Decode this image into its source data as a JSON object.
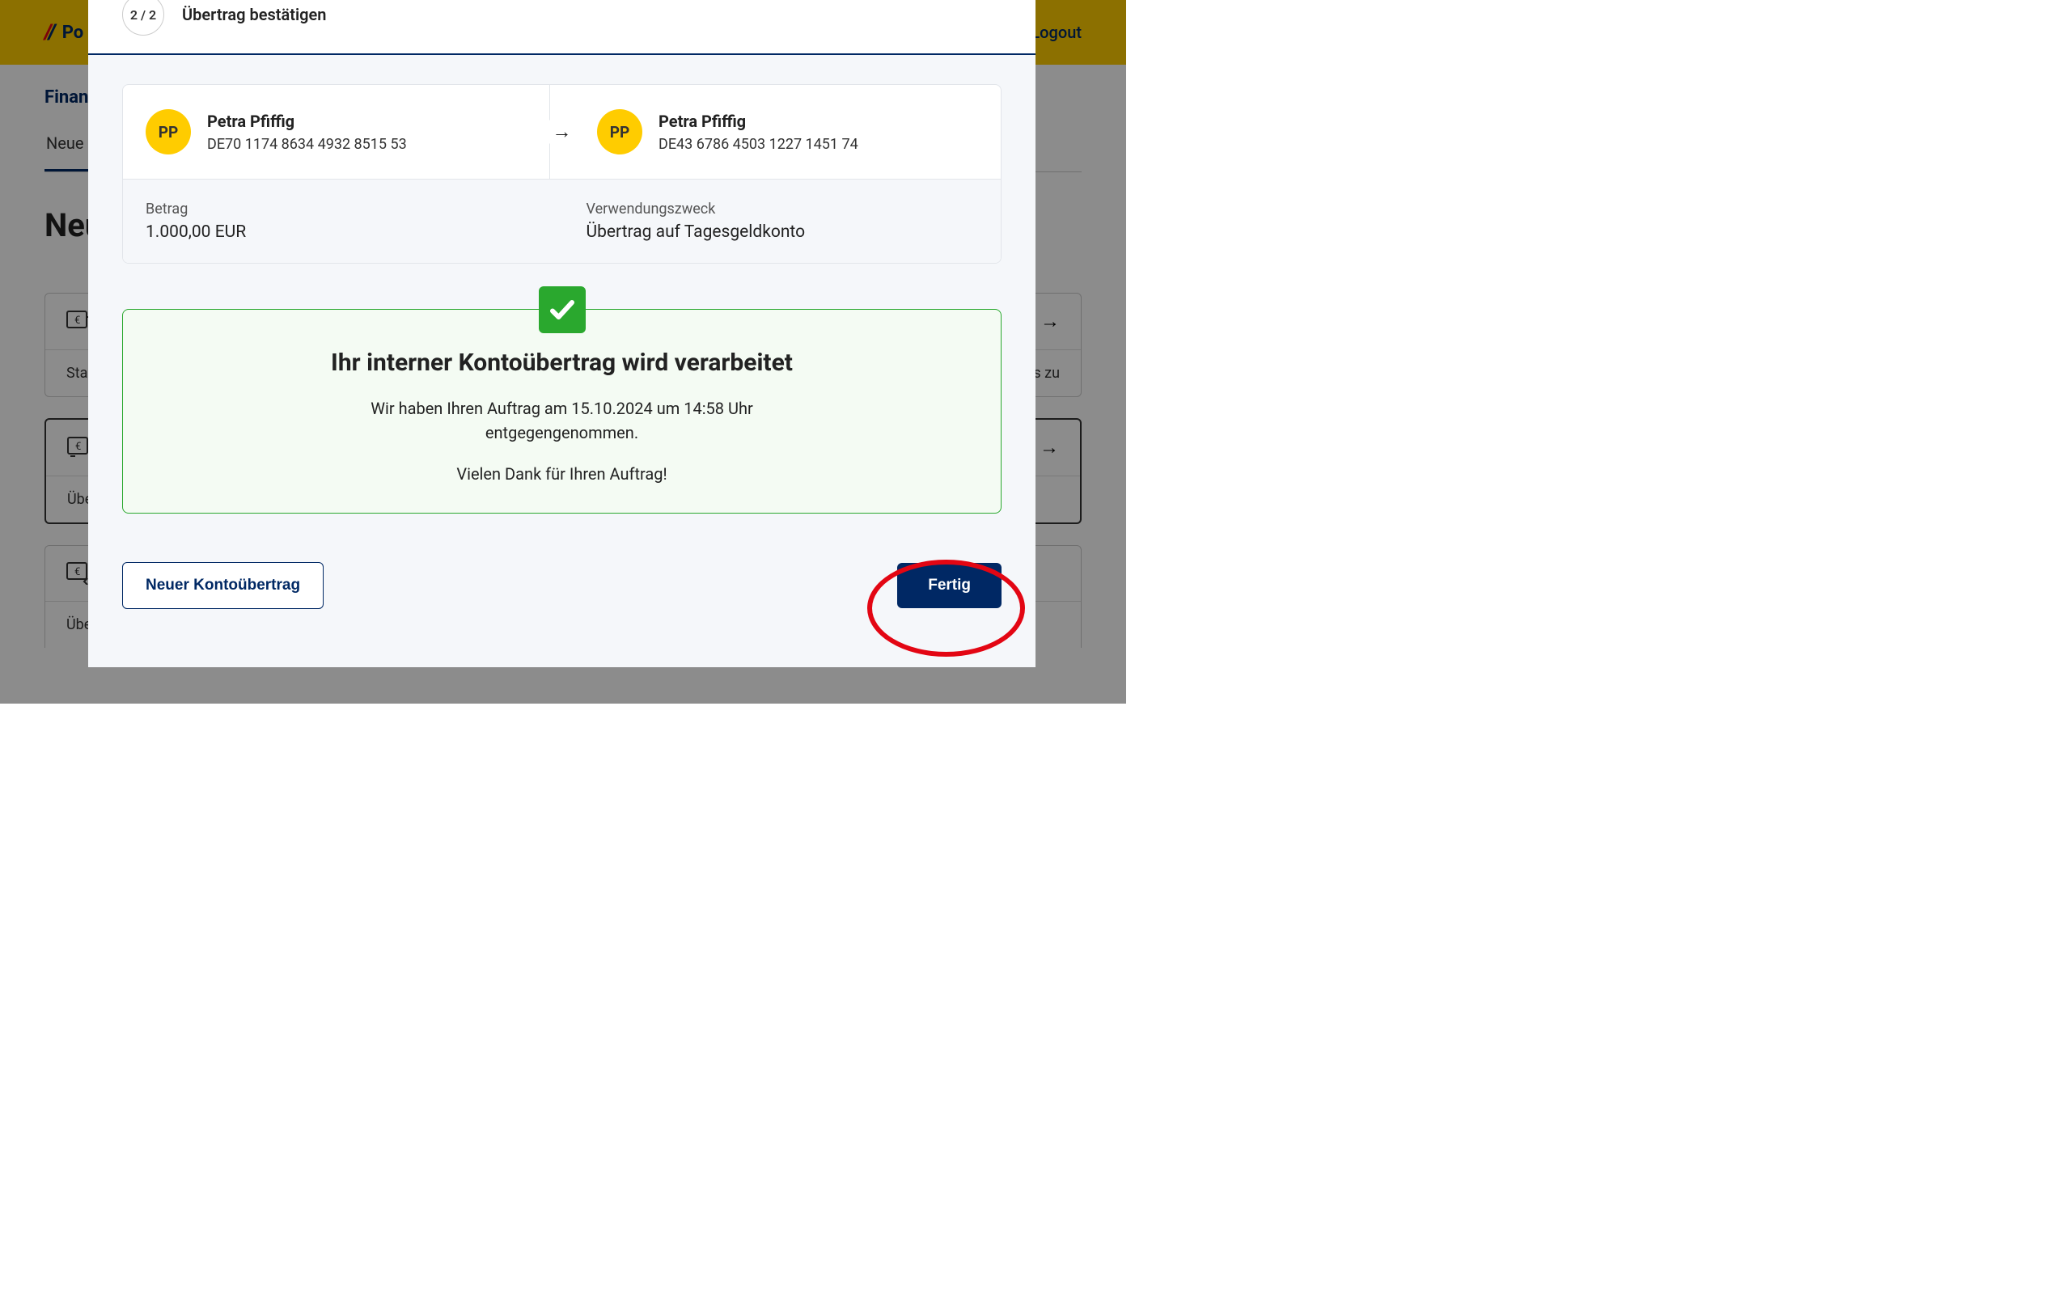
{
  "bg": {
    "logo_text": "Po",
    "logout": "Logout",
    "nav_title": "Finanz",
    "nav_tab": "Neue Ü",
    "page_title": "Neu",
    "card1_text": "Stanc",
    "card1_right_text": "s zu",
    "card2_text": "Über",
    "card3_text": "Übertrag von einem Anlage-, Tagesgeld- oder Business Flexgeldkonto auf"
  },
  "modal": {
    "step": "2 / 2",
    "title": "Übertrag bestätigen",
    "from": {
      "initials": "PP",
      "name": "Petra Pfiffig",
      "iban": "DE70 1174 8634 4932 8515 53"
    },
    "to": {
      "initials": "PP",
      "name": "Petra Pfiffig",
      "iban": "DE43 6786 4503 1227 1451 74"
    },
    "amount_label": "Betrag",
    "amount_value": "1.000,00 EUR",
    "purpose_label": "Verwendungszweck",
    "purpose_value": "Übertrag auf Tagesgeldkonto",
    "success_title": "Ihr interner Kontoübertrag wird verarbeitet",
    "success_text": "Wir haben Ihren Auftrag am 15.10.2024 um 14:58 Uhr entgegengenommen.",
    "success_thanks": "Vielen Dank für Ihren Auftrag!",
    "btn_new": "Neuer Kontoübertrag",
    "btn_done": "Fertig"
  }
}
